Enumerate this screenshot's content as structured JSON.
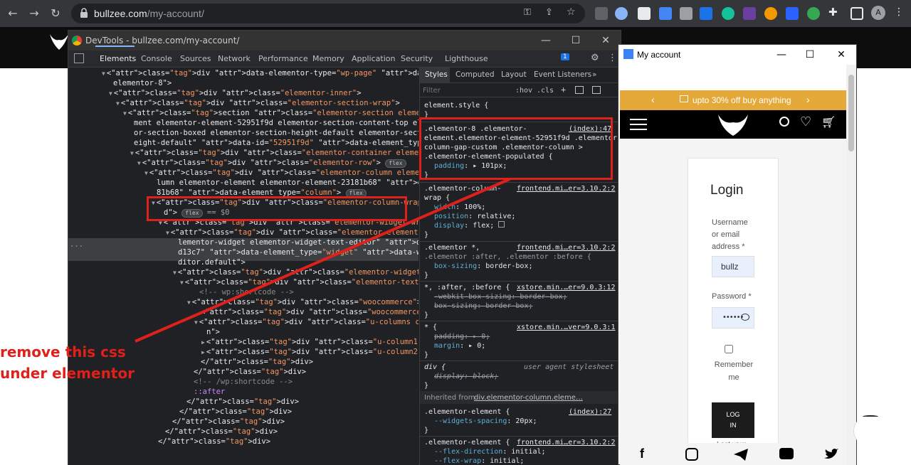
{
  "browser": {
    "url_host": "bullzee.com",
    "url_path": "/my-account/"
  },
  "devtools": {
    "window_title": "DevTools - bullzee.com/my-account/",
    "tabs": [
      "Elements",
      "Console",
      "Sources",
      "Network",
      "Performance",
      "Memory",
      "Application",
      "Security",
      "Lighthouse"
    ],
    "issues_badge": "1",
    "styles_tabs": [
      "Styles",
      "Computed",
      "Layout",
      "Event Listeners"
    ],
    "filter_placeholder": "Filter",
    "hov_label": ":hov",
    "cls_label": ".cls",
    "dom_lines": [
      "<div data-elementor-type=\"wp-page\" data-elementor-id=\"8\" class=\"elementor",
      "elementor-8\">",
      "<div class=\"elementor-inner\">",
      "<div class=\"elementor-section-wrap\">",
      "<section class=\"elementor-section elementor-top-section elementor-ele",
      "ment elementor-element-52951f9d elementor-section-content-top element",
      "or-section-boxed elementor-section-height-default elementor-section-h",
      "eight-default\" data-id=\"52951f9d\" data-element_type=\"section\">",
      "<div class=\"elementor-container elementor-column-gap-custom\">",
      "<div class=\"elementor-row\">",
      "<div class=\"elementor-column elementor-col-100 elementor-top-co",
      "lumn elementor-element elementor-element-23181b68\" data-id=\"231",
      "81b68\" data-element_type=\"column\">",
      "<div class=\"elementor-column-wrap elementor-element-populate",
      "d\">",
      "<div class=\"elementor-widget-wrap\">",
      "<div class=\"elementor-element elementor-element-388d13c7 e",
      "lementor-widget elementor-widget-text-editor\" data-id=\"388",
      "d13c7\" data-element_type=\"widget\" data-widget_type=\"text-e",
      "ditor.default\">",
      "<div class=\"elementor-widget-container\">",
      "<div class=\"elementor-text-editor elementor-clearfix\">",
      "<!-- wp:shortcode -->",
      "<div class=\"woocommerce\">",
      "<div class=\"woocommerce-notices-wrapper\"></div>",
      "<div class=\"u-columns col2-set\" id=\"customer_logi",
      "n\">",
      "<div class=\"u-column1 col-1\">…</div>",
      "<div class=\"u-column2 col-2\">…</div>",
      "</div>",
      "</div>",
      "<!-- /wp:shortcode -->",
      "::after",
      "</div>",
      "</div>",
      "</div>",
      "</div>",
      "</div>"
    ],
    "flex_badge": "flex",
    "selected_suffix": "== $0",
    "styles": {
      "element_style": "element.style {",
      "close_brace": "}",
      "rule1_sel_1": ".elementor-8 .elementor-",
      "rule1_sel_2": "element.elementor-element-52951f9d .elementor-",
      "rule1_sel_3": "column-gap-custom .elementor-column >",
      "rule1_sel_4": ".elementor-element-populated {",
      "rule1_src": "(index):47",
      "rule1_prop": "padding",
      "rule1_val": "101px;",
      "rule2_sel_1": ".elementor-column-",
      "rule2_sel_2": "wrap {",
      "rule2_src": "frontend.mi…er=3.10.2:2",
      "rule2_p1": "width",
      "rule2_v1": "100%;",
      "rule2_p2": "position",
      "rule2_v2": "relative;",
      "rule2_p3": "display",
      "rule2_v3": "flex;",
      "rule3_sel_1": ".elementor *,",
      "rule3_sel_2": ".elementor :after, .elementor :before {",
      "rule3_src": "frontend.mi…er=3.10.2:2",
      "rule3_p1": "box-sizing",
      "rule3_v1": "border-box;",
      "rule4_sel": "*, :after, :before {",
      "rule4_src": "xstore.min.…er=9.0.3:12",
      "rule4_p1": "-webkit-box-sizing",
      "rule4_v1": "border-box;",
      "rule4_p2": "box-sizing",
      "rule4_v2": "border-box;",
      "rule5_sel": "* {",
      "rule5_src": "xstore.min.…ver=9.0.3:1",
      "rule5_p1": "padding",
      "rule5_v1": "0;",
      "rule5_p2": "margin",
      "rule5_v2": "0;",
      "rule6_sel": "div {",
      "rule6_src": "user agent stylesheet",
      "rule6_p1": "display",
      "rule6_v1": "block;",
      "inherited_label": "Inherited from",
      "inherited_sel": "div.elementor-column.eleme…",
      "rule7_sel": ".elementor-element {",
      "rule7_src": "(index):27",
      "rule7_p1": "--widgets-spacing",
      "rule7_v1": "20px;",
      "rule8_sel": ".elementor-element {",
      "rule8_src": "frontend.mi…er=3.10.2:2",
      "rule8_p1": "--flex-direction",
      "rule8_v1": "initial;",
      "rule8_p2": "--flex-wrap",
      "rule8_v2": "initial;"
    }
  },
  "preview": {
    "window_title": "My account",
    "promo_text": "upto 30% off buy anything",
    "login_title": "Login",
    "username_label_1": "Username",
    "username_label_2": "or email",
    "username_label_3": "address *",
    "username_value": "bullz",
    "password_label": "Password *",
    "password_value": "••••••",
    "remember_1": "Remember",
    "remember_2": "me",
    "login_btn_1": "LOG",
    "login_btn_2": "IN",
    "lost_password": "Lost your"
  },
  "annotation": {
    "line1": "remove this css",
    "line2": "under elementor"
  },
  "colors": {
    "annotation_red": "#e0201b",
    "promo_orange": "#e5a93a"
  }
}
